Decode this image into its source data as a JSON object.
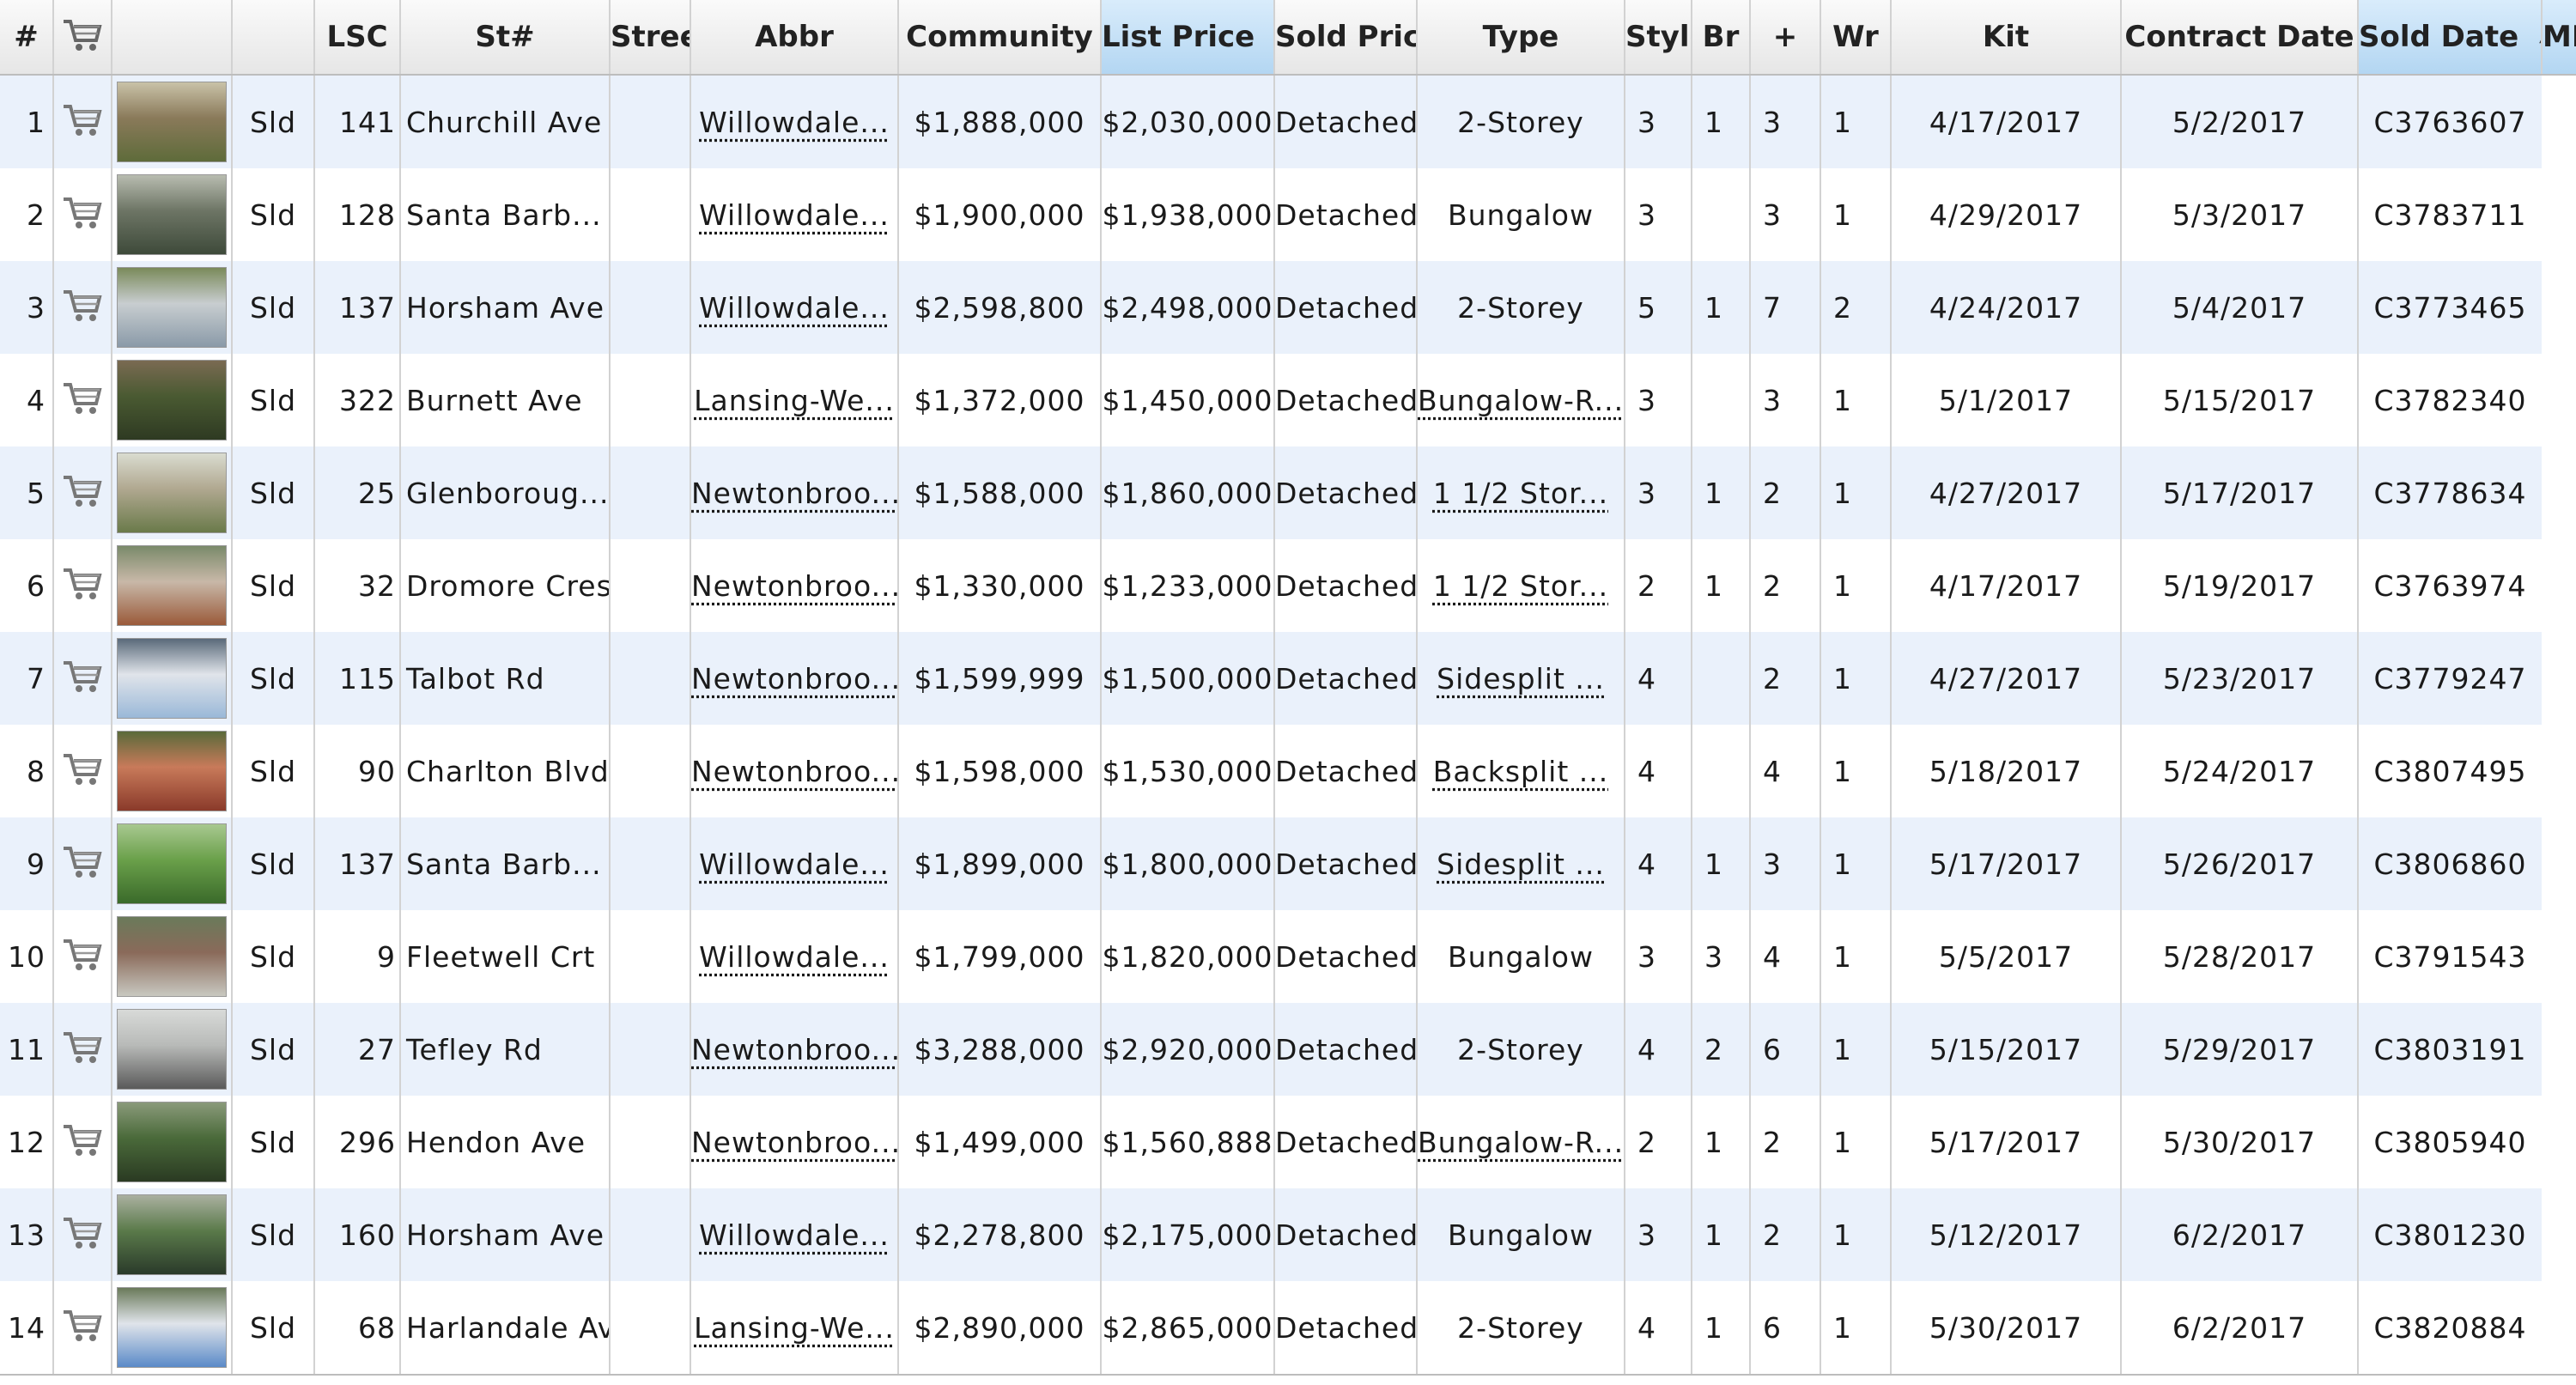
{
  "columns": {
    "num": "#",
    "lsc": "LSC",
    "st": "St#",
    "street": "Street Name",
    "abbr": "Abbr",
    "community": "Community",
    "list_price": "List Price",
    "sold_price": "Sold Price",
    "type": "Type",
    "style": "Style",
    "br": "Br",
    "plus": "+",
    "wr": "Wr",
    "kit": "Kit",
    "contract_date": "Contract Date",
    "sold_date": "Sold Date",
    "mls": "MLS#"
  },
  "sort_indicators": {
    "list_price": "▲",
    "sold_date": "▲"
  },
  "colors": {
    "sorted_header": "#b3d6f2",
    "row_alt": "#eaf1fb"
  },
  "icons": {
    "cart": "shopping-cart-icon",
    "photo": "property-thumbnail"
  },
  "rows": [
    {
      "n": "1",
      "lsc": "Sld",
      "st": "141",
      "street": "Churchill Ave",
      "abbr": "",
      "community": "Willowdale...",
      "list": "$1,888,000",
      "sold": "$2,030,000",
      "type": "Detached",
      "style": "2-Storey",
      "style_link": false,
      "br": "3",
      "plus": "1",
      "wr": "3",
      "kit": "1",
      "contract": "4/17/2017",
      "solddate": "5/2/2017",
      "mls": "C3763607",
      "photo": [
        "#5e6b3a",
        "#8a7a5a",
        "#c9c2a8"
      ]
    },
    {
      "n": "2",
      "lsc": "Sld",
      "st": "128",
      "street": "Santa Barb... Rd",
      "abbr": "",
      "community": "Willowdale...",
      "list": "$1,900,000",
      "sold": "$1,938,000",
      "type": "Detached",
      "style": "Bungalow",
      "style_link": false,
      "br": "3",
      "plus": "",
      "wr": "3",
      "kit": "1",
      "contract": "4/29/2017",
      "solddate": "5/3/2017",
      "mls": "C3783711",
      "photo": [
        "#3e4a3a",
        "#6d7565",
        "#b8bcb0"
      ]
    },
    {
      "n": "3",
      "lsc": "Sld",
      "st": "137",
      "street": "Horsham Ave",
      "abbr": "",
      "community": "Willowdale...",
      "list": "$2,598,800",
      "sold": "$2,498,000",
      "type": "Detached",
      "style": "2-Storey",
      "style_link": false,
      "br": "5",
      "plus": "1",
      "wr": "7",
      "kit": "2",
      "contract": "4/24/2017",
      "solddate": "5/4/2017",
      "mls": "C3773465",
      "photo": [
        "#8a9aa8",
        "#c8cdd0",
        "#7a8a5a"
      ]
    },
    {
      "n": "4",
      "lsc": "Sld",
      "st": "322",
      "street": "Burnett Ave",
      "abbr": "",
      "community": "Lansing-We...",
      "list": "$1,372,000",
      "sold": "$1,450,000",
      "type": "Detached",
      "style": "Bungalow-R...",
      "style_link": true,
      "br": "3",
      "plus": "",
      "wr": "3",
      "kit": "1",
      "contract": "5/1/2017",
      "solddate": "5/15/2017",
      "mls": "C3782340",
      "photo": [
        "#2e3a22",
        "#4a5a32",
        "#7a6a52"
      ]
    },
    {
      "n": "5",
      "lsc": "Sld",
      "st": "25",
      "street": "Glenboroug... Cres",
      "abbr": "",
      "community": "Newtonbroo...",
      "list": "$1,588,000",
      "sold": "$1,860,000",
      "type": "Detached",
      "style": "1 1/2 Stor...",
      "style_link": true,
      "br": "3",
      "plus": "1",
      "wr": "2",
      "kit": "1",
      "contract": "4/27/2017",
      "solddate": "5/17/2017",
      "mls": "C3778634",
      "photo": [
        "#6a7a4a",
        "#b0a890",
        "#dadcd0"
      ]
    },
    {
      "n": "6",
      "lsc": "Sld",
      "st": "32",
      "street": "Dromore Cres",
      "abbr": "",
      "community": "Newtonbroo...",
      "list": "$1,330,000",
      "sold": "$1,233,000",
      "type": "Detached",
      "style": "1 1/2 Stor...",
      "style_link": true,
      "br": "2",
      "plus": "1",
      "wr": "2",
      "kit": "1",
      "contract": "4/17/2017",
      "solddate": "5/19/2017",
      "mls": "C3763974",
      "photo": [
        "#9a5a3a",
        "#c8b8a8",
        "#7a8a6a"
      ]
    },
    {
      "n": "7",
      "lsc": "Sld",
      "st": "115",
      "street": "Talbot Rd",
      "abbr": "",
      "community": "Newtonbroo...",
      "list": "$1,599,999",
      "sold": "$1,500,000",
      "type": "Detached",
      "style": "Sidesplit ...",
      "style_link": true,
      "br": "4",
      "plus": "",
      "wr": "2",
      "kit": "1",
      "contract": "4/27/2017",
      "solddate": "5/23/2017",
      "mls": "C3779247",
      "photo": [
        "#9ab8d8",
        "#e0e4ea",
        "#5a6a7a"
      ]
    },
    {
      "n": "8",
      "lsc": "Sld",
      "st": "90",
      "street": "Charlton Blvd",
      "abbr": "",
      "community": "Newtonbroo...",
      "list": "$1,598,000",
      "sold": "$1,530,000",
      "type": "Detached",
      "style": "Backsplit ...",
      "style_link": true,
      "br": "4",
      "plus": "",
      "wr": "4",
      "kit": "1",
      "contract": "5/18/2017",
      "solddate": "5/24/2017",
      "mls": "C3807495",
      "photo": [
        "#8a3a2a",
        "#c87a5a",
        "#5a6a3a"
      ]
    },
    {
      "n": "9",
      "lsc": "Sld",
      "st": "137",
      "street": "Santa Barb... Rd",
      "abbr": "",
      "community": "Willowdale...",
      "list": "$1,899,000",
      "sold": "$1,800,000",
      "type": "Detached",
      "style": "Sidesplit ...",
      "style_link": true,
      "br": "4",
      "plus": "1",
      "wr": "3",
      "kit": "1",
      "contract": "5/17/2017",
      "solddate": "5/26/2017",
      "mls": "C3806860",
      "photo": [
        "#3a6a2a",
        "#6aa04a",
        "#a8c890"
      ]
    },
    {
      "n": "10",
      "lsc": "Sld",
      "st": "9",
      "street": "Fleetwell Crt",
      "abbr": "",
      "community": "Willowdale...",
      "list": "$1,799,000",
      "sold": "$1,820,000",
      "type": "Detached",
      "style": "Bungalow",
      "style_link": false,
      "br": "3",
      "plus": "3",
      "wr": "4",
      "kit": "1",
      "contract": "5/5/2017",
      "solddate": "5/28/2017",
      "mls": "C3791543",
      "photo": [
        "#c8c8c0",
        "#8a6a5a",
        "#6a7a5a"
      ]
    },
    {
      "n": "11",
      "lsc": "Sld",
      "st": "27",
      "street": "Tefley Rd",
      "abbr": "",
      "community": "Newtonbroo...",
      "list": "$3,288,000",
      "sold": "$2,920,000",
      "type": "Detached",
      "style": "2-Storey",
      "style_link": false,
      "br": "4",
      "plus": "2",
      "wr": "6",
      "kit": "1",
      "contract": "5/15/2017",
      "solddate": "5/29/2017",
      "mls": "C3803191",
      "photo": [
        "#5a5a5a",
        "#b8bab8",
        "#d8dad8"
      ]
    },
    {
      "n": "12",
      "lsc": "Sld",
      "st": "296",
      "street": "Hendon Ave",
      "abbr": "",
      "community": "Newtonbroo...",
      "list": "$1,499,000",
      "sold": "$1,560,888",
      "type": "Detached",
      "style": "Bungalow-R...",
      "style_link": true,
      "br": "2",
      "plus": "1",
      "wr": "2",
      "kit": "1",
      "contract": "5/17/2017",
      "solddate": "5/30/2017",
      "mls": "C3805940",
      "photo": [
        "#2a3a22",
        "#4a6a3a",
        "#8a9a7a"
      ]
    },
    {
      "n": "13",
      "lsc": "Sld",
      "st": "160",
      "street": "Horsham Ave",
      "abbr": "",
      "community": "Willowdale...",
      "list": "$2,278,800",
      "sold": "$2,175,000",
      "type": "Detached",
      "style": "Bungalow",
      "style_link": false,
      "br": "3",
      "plus": "1",
      "wr": "2",
      "kit": "1",
      "contract": "5/12/2017",
      "solddate": "6/2/2017",
      "mls": "C3801230",
      "photo": [
        "#2a3a2a",
        "#5a7a4a",
        "#aab0a0"
      ]
    },
    {
      "n": "14",
      "lsc": "Sld",
      "st": "68",
      "street": "Harlandale Ave",
      "abbr": "",
      "community": "Lansing-We...",
      "list": "$2,890,000",
      "sold": "$2,865,000",
      "type": "Detached",
      "style": "2-Storey",
      "style_link": false,
      "br": "4",
      "plus": "1",
      "wr": "6",
      "kit": "1",
      "contract": "5/30/2017",
      "solddate": "6/2/2017",
      "mls": "C3820884",
      "photo": [
        "#5a8ac8",
        "#e0e4ea",
        "#6a7a5a"
      ]
    }
  ]
}
